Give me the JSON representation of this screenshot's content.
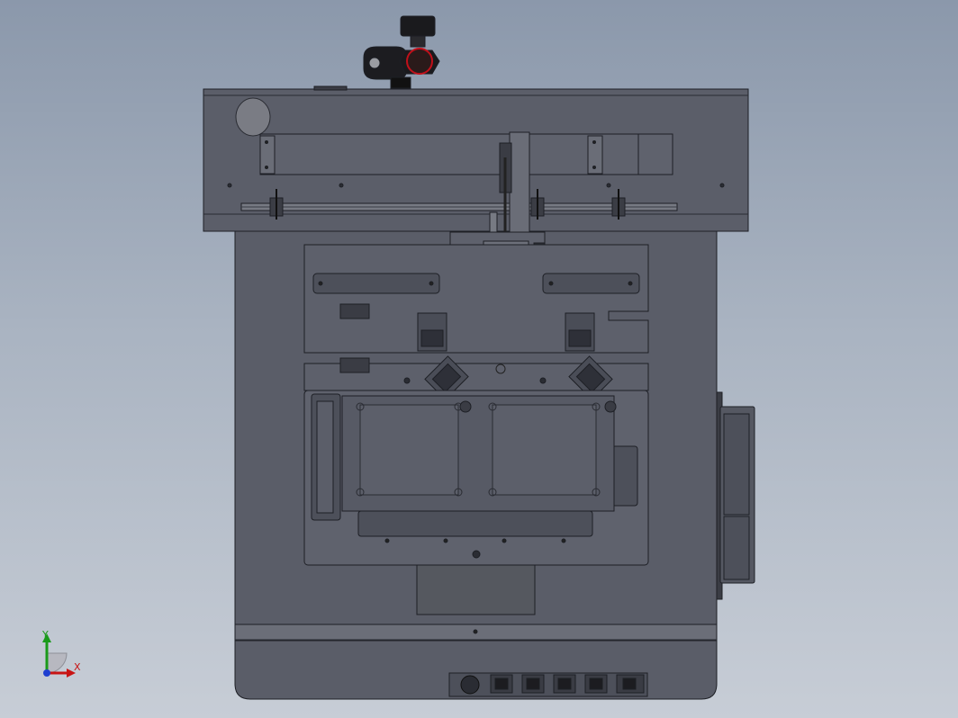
{
  "view": {
    "type": "CAD model viewport (front view)",
    "background": {
      "top": "#8b98ab",
      "bottom": "#c7cdd6"
    },
    "model_colors": {
      "body": "#585b66",
      "panel": "#61646f",
      "edge": "#1d1f25",
      "light_edge": "#8a8d96",
      "highlight_red": "#c0101a"
    }
  },
  "axis_triad": {
    "x_label": "X",
    "y_label": "Y",
    "x_color": "#c81414",
    "y_color": "#1a9a1a",
    "z_color": "#1f3fd0"
  },
  "control_panel": {
    "button_count": 5,
    "knob": "round-knob-icon"
  }
}
